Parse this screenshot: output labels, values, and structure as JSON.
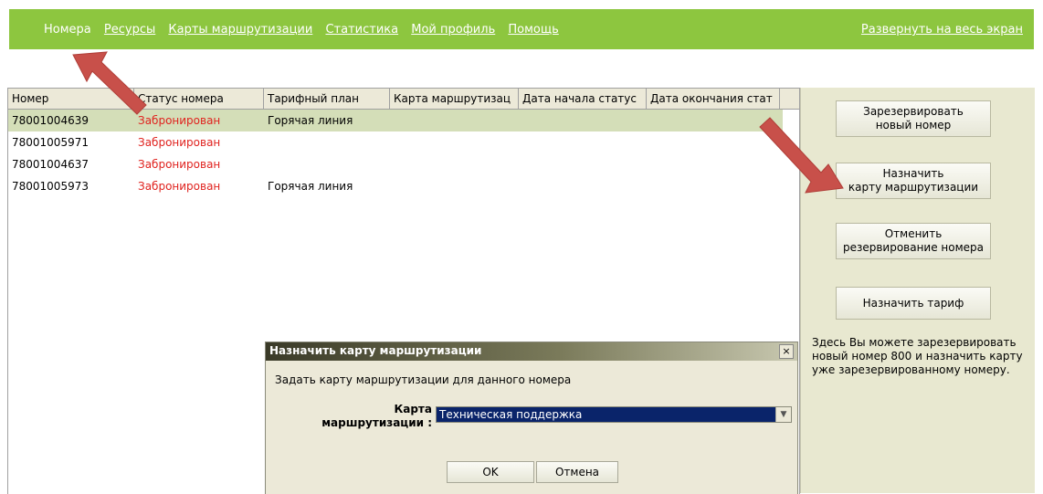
{
  "nav": {
    "items": [
      {
        "label": "Номера",
        "active": true
      },
      {
        "label": "Ресурсы",
        "active": false
      },
      {
        "label": "Карты маршрутизации",
        "active": false
      },
      {
        "label": "Статистика",
        "active": false
      },
      {
        "label": "Мой профиль",
        "active": false
      },
      {
        "label": "Помощь",
        "active": false
      }
    ],
    "fullscreen": "Развернуть на весь экран"
  },
  "grid": {
    "columns": [
      "Номер",
      "Статус номера",
      "Тарифный план",
      "Карта маршрутизац",
      "Дата начала статус",
      "Дата окончания стат"
    ],
    "rows": [
      {
        "number": "78001004639",
        "status": "Забронирован",
        "plan": "Горячая линия",
        "selected": true
      },
      {
        "number": "78001005971",
        "status": "Забронирован",
        "plan": ""
      },
      {
        "number": "78001004637",
        "status": "Забронирован",
        "plan": ""
      },
      {
        "number": "78001005973",
        "status": "Забронирован",
        "plan": "Горячая линия"
      }
    ]
  },
  "panel": {
    "reserve": "Зарезервировать\nновый номер",
    "assign": "Назначить\nкарту маршрутизации",
    "cancel": "Отменить\nрезервирование номера",
    "tariff": "Назначить тариф",
    "help": "Здесь Вы можете зарезервировать новый номер 800 и назначить карту уже зарезервированному номеру."
  },
  "dialog": {
    "title": "Назначить карту маршрутизации",
    "close": "×",
    "text": "Задать карту маршрутизации для данного номера",
    "label_line1": "Карта",
    "label_line2": "маршрутизации :",
    "selected": "Техническая поддержка",
    "ok": "OK",
    "cancel": "Отмена"
  },
  "colors": {
    "nav_bg": "#8dc63f",
    "status": "#e0231f",
    "arrow": "#c8504a",
    "selection": "#0a246a"
  }
}
